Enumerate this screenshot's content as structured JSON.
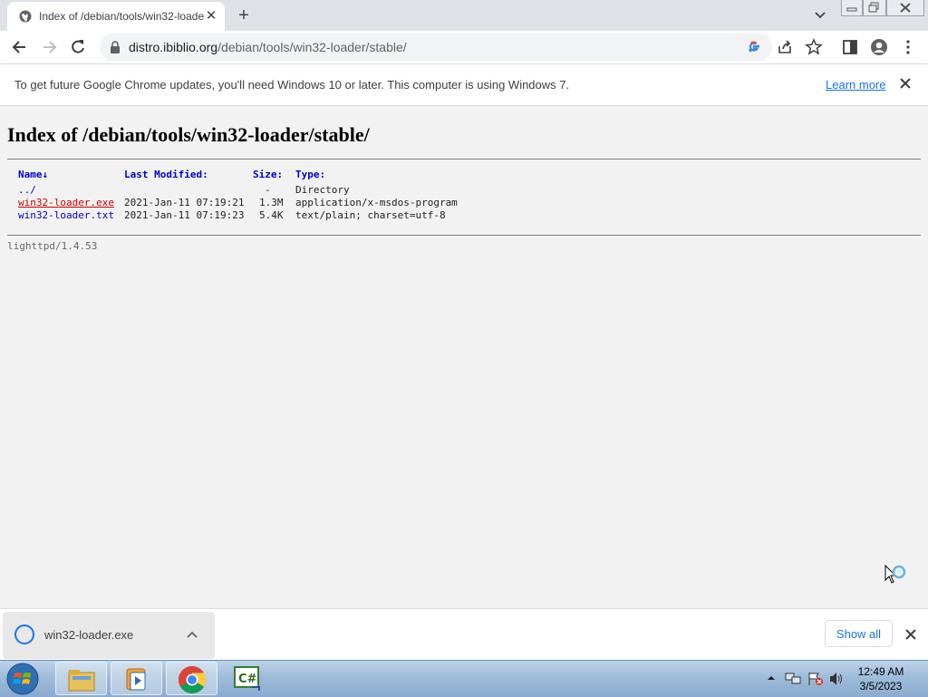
{
  "browser": {
    "tab_title": "Index of /debian/tools/win32-loader/stable/",
    "tab_close_icon": "close-icon",
    "new_tab_icon": "plus-icon",
    "url_host": "distro.ibiblio.org",
    "url_path": "/debian/tools/win32-loader/stable/"
  },
  "infobar": {
    "message": "To get future Google Chrome updates, you'll need Windows 10 or later. This computer is using Windows 7.",
    "learn_more": "Learn more"
  },
  "page": {
    "title": "Index of /debian/tools/win32-loader/stable/",
    "columns": {
      "name": "Name↓",
      "modified": "Last Modified:",
      "size": "Size:",
      "type": "Type:"
    },
    "rows": [
      {
        "name": "../",
        "modified": "",
        "size": "-",
        "type": "Directory",
        "visited": false
      },
      {
        "name": "win32-loader.exe",
        "modified": "2021-Jan-11 07:19:21",
        "size": "1.3M",
        "type": "application/x-msdos-program",
        "visited": true
      },
      {
        "name": "win32-loader.txt",
        "modified": "2021-Jan-11 07:19:23",
        "size": "5.4K",
        "type": "text/plain; charset=utf-8",
        "visited": false
      }
    ],
    "server": "lighttpd/1.4.53"
  },
  "downloads": {
    "file": "win32-loader.exe",
    "show_all": "Show all"
  },
  "taskbar": {
    "time": "12:49 AM",
    "date": "3/5/2023",
    "apps": [
      "windows-explorer",
      "media-player",
      "google-chrome",
      "csharp-editor"
    ]
  },
  "colors": {
    "link": "#0000cc",
    "visited": "#cc0000",
    "accent": "#1a73e8"
  }
}
